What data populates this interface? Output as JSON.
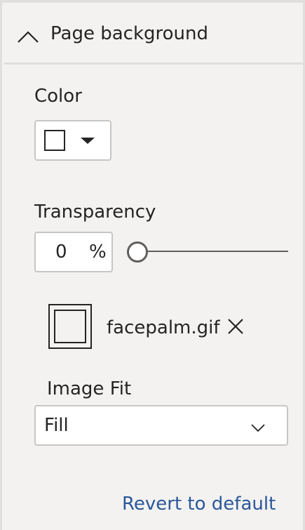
{
  "section": {
    "title": "Page background",
    "expanded": true,
    "collapse_icon": "chevron-up-icon"
  },
  "color": {
    "label": "Color",
    "value": "#ffffff",
    "dropdown_icon": "caret-down-icon"
  },
  "transparency": {
    "label": "Transparency",
    "value": "0",
    "unit": "%",
    "slider_level": 0
  },
  "image": {
    "file_name": "facepalm.gif",
    "thumbnail_icon": "image-thumbnail-icon",
    "remove_icon": "close-icon"
  },
  "image_fit": {
    "label": "Image Fit",
    "selected": "Fill",
    "dropdown_icon": "chevron-down-icon"
  },
  "footer": {
    "revert_label": "Revert to default",
    "link_color": "#2b579a"
  }
}
